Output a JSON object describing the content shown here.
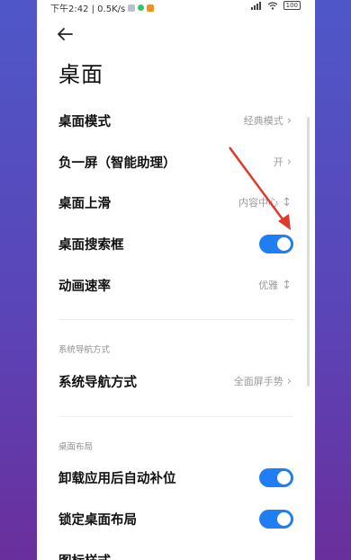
{
  "status_bar": {
    "time_speed": "下午2:42 | 0.5K/s",
    "battery": "100"
  },
  "title": "桌面",
  "rows": [
    {
      "label": "桌面模式",
      "value": "经典模式"
    },
    {
      "label": "负一屏（智能助理）",
      "value": "开"
    },
    {
      "label": "桌面上滑",
      "value": "内容中心"
    },
    {
      "label": "桌面搜索框",
      "toggle_on": true
    },
    {
      "label": "动画速率",
      "value": "优雅"
    }
  ],
  "sections": {
    "nav": {
      "header": "系统导航方式",
      "row": {
        "label": "系统导航方式",
        "value": "全面屏手势"
      }
    },
    "layout": {
      "header": "桌面布局",
      "rows": [
        {
          "label": "卸载应用后自动补位",
          "toggle_on": true
        },
        {
          "label": "锁定桌面布局",
          "toggle_on": true
        },
        {
          "label": "图标样式"
        }
      ]
    }
  },
  "colors": {
    "accent": "#1f7ef4",
    "annotation_arrow": "#e23a2a"
  }
}
